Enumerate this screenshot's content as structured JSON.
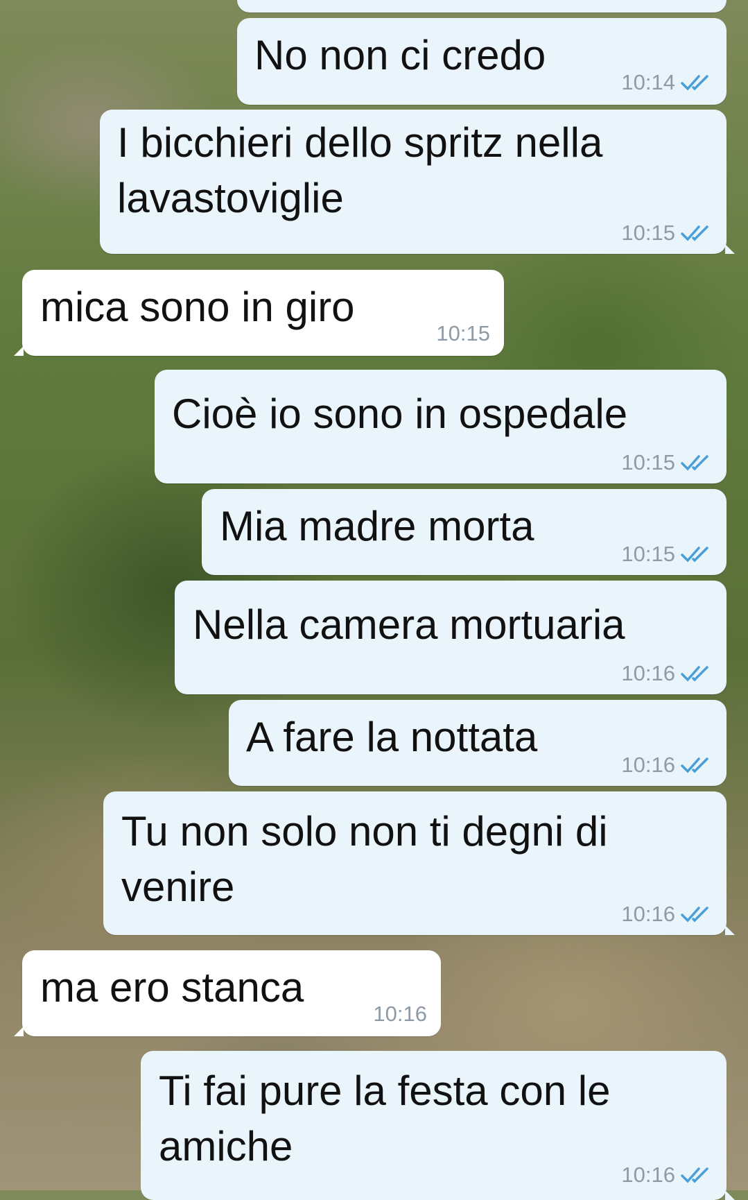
{
  "colors": {
    "outgoing_bubble": "#e9f4fb",
    "incoming_bubble": "#ffffff",
    "timestamp": "#8e9aa5",
    "read_ticks": "#4a9fd8"
  },
  "messages": [
    {
      "text": "No non ci credo",
      "time": "10:14",
      "direction": "out",
      "status_icon": "double-check-icon"
    },
    {
      "text": "I bicchieri dello spritz nella\nlavastoviglie",
      "time": "10:15",
      "direction": "out",
      "status_icon": "double-check-icon"
    },
    {
      "text": "mica sono in giro",
      "time": "10:15",
      "direction": "in"
    },
    {
      "text": "Cioè io sono in ospedale",
      "time": "10:15",
      "direction": "out",
      "status_icon": "double-check-icon"
    },
    {
      "text": "Mia madre morta",
      "time": "10:15",
      "direction": "out",
      "status_icon": "double-check-icon"
    },
    {
      "text": "Nella camera mortuaria",
      "time": "10:16",
      "direction": "out",
      "status_icon": "double-check-icon"
    },
    {
      "text": "A fare la nottata",
      "time": "10:16",
      "direction": "out",
      "status_icon": "double-check-icon"
    },
    {
      "text": "Tu non solo non ti degni di\nvenire",
      "time": "10:16",
      "direction": "out",
      "status_icon": "double-check-icon"
    },
    {
      "text": "ma ero stanca",
      "time": "10:16",
      "direction": "in"
    },
    {
      "text": "Ti fai pure la festa con le\namiche",
      "time": "10:16",
      "direction": "out",
      "status_icon": "double-check-icon"
    }
  ]
}
